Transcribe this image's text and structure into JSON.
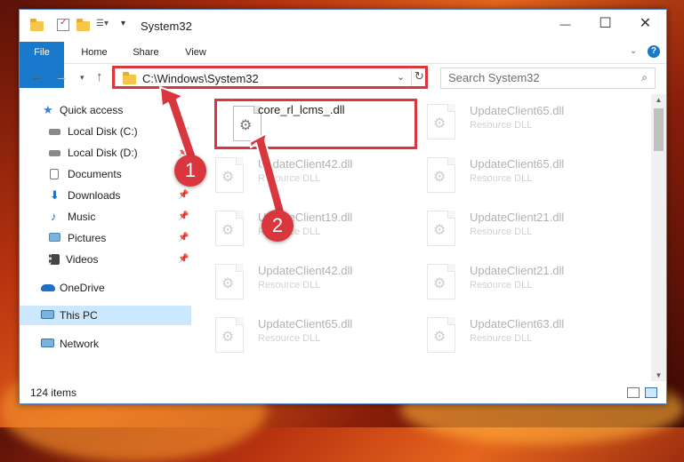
{
  "window": {
    "title": "System32",
    "controls": {
      "minimize": "—",
      "maximize": "☐",
      "close": "✕"
    }
  },
  "ribbon": {
    "tabs": [
      {
        "label": "File"
      },
      {
        "label": "Home"
      },
      {
        "label": "Share"
      },
      {
        "label": "View"
      }
    ]
  },
  "address": {
    "path": "C:\\Windows\\System32",
    "search_placeholder": "Search System32"
  },
  "nav_pane": {
    "items": [
      {
        "label": "Quick access",
        "icon": "star-icon"
      },
      {
        "label": "Local Disk (C:)",
        "icon": "drive-icon",
        "pinned": true
      },
      {
        "label": "Local Disk (D:)",
        "icon": "drive-icon",
        "pinned": true
      },
      {
        "label": "Documents",
        "icon": "documents-icon",
        "pinned": true
      },
      {
        "label": "Downloads",
        "icon": "downloads-icon",
        "pinned": true
      },
      {
        "label": "Music",
        "icon": "music-icon",
        "pinned": true
      },
      {
        "label": "Pictures",
        "icon": "pictures-icon",
        "pinned": true
      },
      {
        "label": "Videos",
        "icon": "videos-icon",
        "pinned": true
      },
      {
        "label": "OneDrive",
        "icon": "onedrive-icon"
      },
      {
        "label": "This PC",
        "icon": "computer-icon",
        "selected": true
      },
      {
        "label": "Network",
        "icon": "network-icon"
      }
    ]
  },
  "files": [
    {
      "name": "core_rl_lcms_.dll",
      "type": ""
    },
    {
      "name": "UpdateClient65.dll",
      "type": "Resource DLL"
    },
    {
      "name": "UpdateClient42.dll",
      "type": "Resource DLL"
    },
    {
      "name": "UpdateClient65.dll",
      "type": "Resource DLL"
    },
    {
      "name": "UpdateClient19.dll",
      "type": "Resource DLL"
    },
    {
      "name": "UpdateClient21.dll",
      "type": "Resource DLL"
    },
    {
      "name": "UpdateClient42.dll",
      "type": "Resource DLL"
    },
    {
      "name": "UpdateClient21.dll",
      "type": "Resource DLL"
    },
    {
      "name": "UpdateClient65.dll",
      "type": "Resource DLL"
    },
    {
      "name": "UpdateClient63.dll",
      "type": "Resource DLL"
    }
  ],
  "status": {
    "item_count": "124 items"
  },
  "annotations": {
    "step1": "1",
    "step2": "2",
    "color": "#d9363e"
  }
}
